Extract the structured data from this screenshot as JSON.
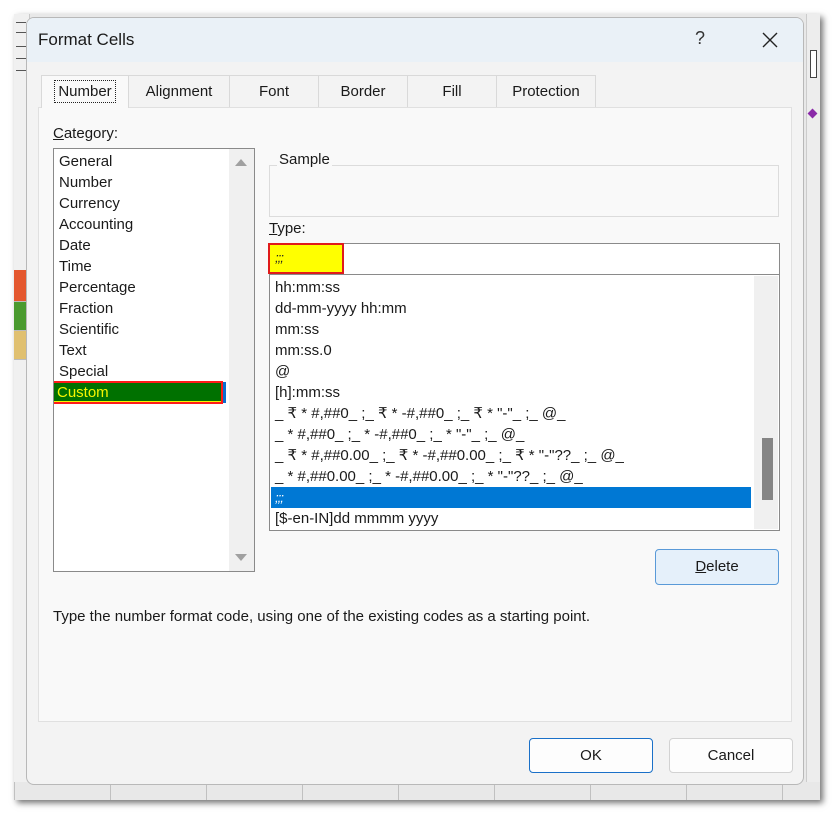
{
  "dialog": {
    "title": "Format Cells",
    "help_label": "?",
    "tabs": [
      {
        "label": "Number",
        "active": true
      },
      {
        "label": "Alignment",
        "active": false
      },
      {
        "label": "Font",
        "active": false
      },
      {
        "label": "Border",
        "active": false
      },
      {
        "label": "Fill",
        "active": false
      },
      {
        "label": "Protection",
        "active": false
      }
    ]
  },
  "number_tab": {
    "category_label_accel": "C",
    "category_label_rest": "ategory:",
    "categories": [
      {
        "label": "General"
      },
      {
        "label": "Number"
      },
      {
        "label": "Currency"
      },
      {
        "label": "Accounting"
      },
      {
        "label": "Date"
      },
      {
        "label": "Time"
      },
      {
        "label": "Percentage"
      },
      {
        "label": "Fraction"
      },
      {
        "label": "Scientific"
      },
      {
        "label": "Text"
      },
      {
        "label": "Special"
      },
      {
        "label": "Custom",
        "selected": true
      }
    ],
    "sample_label": "Sample",
    "sample_value": "",
    "type_label_accel": "T",
    "type_label_rest": "ype:",
    "type_value": ";;;",
    "formats": [
      {
        "label": "hh:mm:ss"
      },
      {
        "label": "dd-mm-yyyy hh:mm"
      },
      {
        "label": "mm:ss"
      },
      {
        "label": "mm:ss.0"
      },
      {
        "label": "@"
      },
      {
        "label": "[h]:mm:ss"
      },
      {
        "label": "_ ₹ * #,##0_ ;_ ₹ * -#,##0_ ;_ ₹ * \"-\"_ ;_ @_"
      },
      {
        "label": "_ * #,##0_ ;_ * -#,##0_ ;_ * \"-\"_ ;_ @_"
      },
      {
        "label": "_ ₹ * #,##0.00_ ;_ ₹ * -#,##0.00_ ;_ ₹ * \"-\"??_ ;_ @_"
      },
      {
        "label": "_ * #,##0.00_ ;_ * -#,##0.00_ ;_ * \"-\"??_ ;_ @_"
      },
      {
        "label": ";;;",
        "selected": true
      },
      {
        "label": "[$-en-IN]dd mmmm yyyy"
      }
    ],
    "delete_label_accel": "D",
    "delete_label_rest": "elete",
    "hint": "Type the number format code, using one of the existing codes as a starting point."
  },
  "footer": {
    "ok_label": "OK",
    "cancel_label": "Cancel"
  },
  "colors": {
    "selected_category_bg": "#007100",
    "selected_category_text": "#f5f500",
    "highlight_border": "#e01b1b",
    "type_highlight": "#ffff00",
    "list_selection": "#0078d4"
  }
}
